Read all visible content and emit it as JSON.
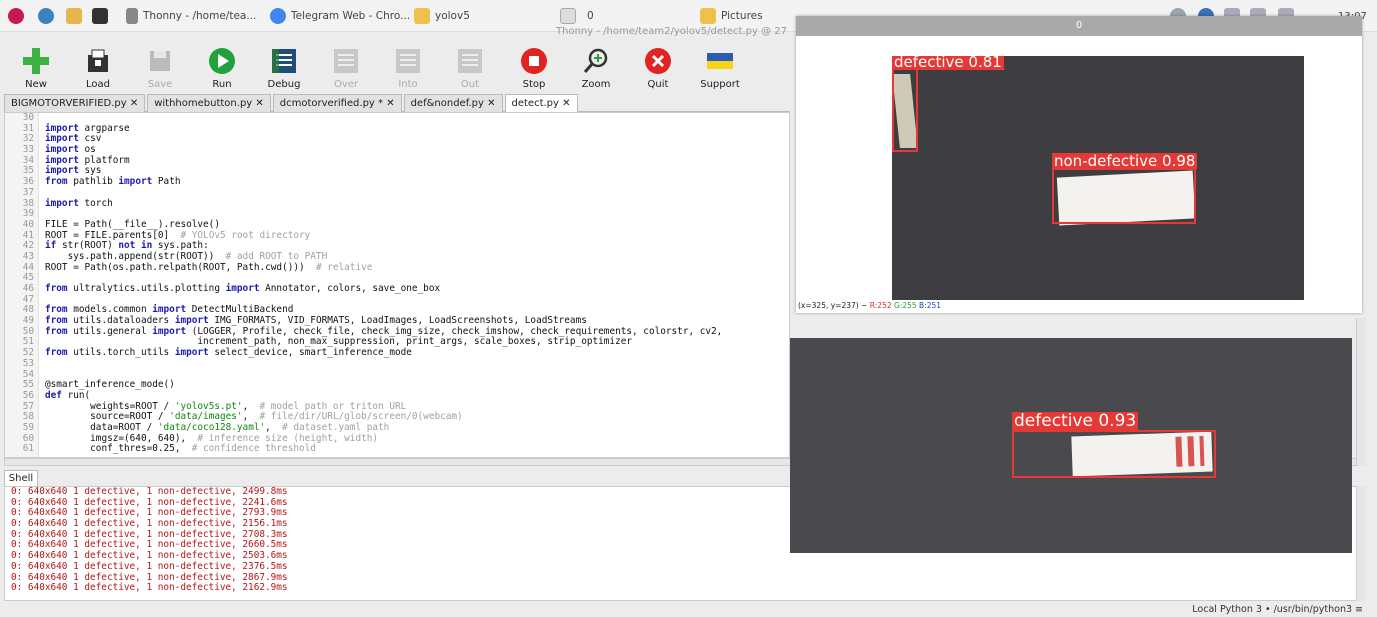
{
  "taskbar": {
    "items": [
      {
        "label": "Thonny - /home/tea..."
      },
      {
        "label": "Telegram Web - Chro..."
      },
      {
        "label": "yolov5"
      },
      {
        "label": "0"
      },
      {
        "label": "Pictures"
      }
    ],
    "clock": "13:07"
  },
  "window_title": "Thonny - /home/team2/yolov5/detect.py @ 27",
  "toolbar": {
    "new": "New",
    "load": "Load",
    "save": "Save",
    "run": "Run",
    "debug": "Debug",
    "over": "Over",
    "into": "Into",
    "out": "Out",
    "stop": "Stop",
    "zoom": "Zoom",
    "quit": "Quit",
    "support": "Support"
  },
  "editor_tabs": [
    {
      "label": "BIGMOTORVERIFIED.py ✕"
    },
    {
      "label": "withhomebutton.py ✕"
    },
    {
      "label": "dcmotorverified.py * ✕"
    },
    {
      "label": "def&nondef.py ✕"
    },
    {
      "label": "detect.py ✕"
    }
  ],
  "code": {
    "line_numbers": [
      "30",
      "31",
      "32",
      "33",
      "34",
      "35",
      "36",
      "37",
      "38",
      "39",
      "40",
      "41",
      "42",
      "43",
      "44",
      "45",
      "46",
      "47",
      "48",
      "49",
      "50",
      "51",
      "52",
      "53",
      "54",
      "55",
      "56",
      "57",
      "58",
      "59",
      "60",
      "61"
    ],
    "lines": [
      "",
      "import argparse",
      "import csv",
      "import os",
      "import platform",
      "import sys",
      "from pathlib import Path",
      "",
      "import torch",
      "",
      "FILE = Path(__file__).resolve()",
      "ROOT = FILE.parents[0]  # YOLOv5 root directory",
      "if str(ROOT) not in sys.path:",
      "    sys.path.append(str(ROOT))  # add ROOT to PATH",
      "ROOT = Path(os.path.relpath(ROOT, Path.cwd()))  # relative",
      "",
      "from ultralytics.utils.plotting import Annotator, colors, save_one_box",
      "",
      "from models.common import DetectMultiBackend",
      "from utils.dataloaders import IMG_FORMATS, VID_FORMATS, LoadImages, LoadScreenshots, LoadStreams",
      "from utils.general import (LOGGER, Profile, check_file, check_img_size, check_imshow, check_requirements, colorstr, cv2,",
      "                           increment_path, non_max_suppression, print_args, scale_boxes, strip_optimizer",
      "from utils.torch_utils import select_device, smart_inference_mode",
      "",
      "",
      "@smart_inference_mode()",
      "def run(",
      "        weights=ROOT / 'yolov5s.pt',  # model path or triton URL",
      "        source=ROOT / 'data/images',  # file/dir/URL/glob/screen/0(webcam)",
      "        data=ROOT / 'data/coco128.yaml',  # dataset.yaml path",
      "        imgsz=(640, 640),  # inference size (height, width)",
      "        conf_thres=0.25,  # confidence threshold"
    ]
  },
  "shell": {
    "tab_label": "Shell",
    "lines": [
      "0: 640x640 1 defective, 1 non-defective, 2499.8ms",
      "0: 640x640 1 defective, 1 non-defective, 2241.6ms",
      "0: 640x640 1 defective, 1 non-defective, 2793.9ms",
      "0: 640x640 1 defective, 1 non-defective, 2156.1ms",
      "0: 640x640 1 defective, 1 non-defective, 2708.3ms",
      "0: 640x640 1 defective, 1 non-defective, 2660.5ms",
      "0: 640x640 1 defective, 1 non-defective, 2503.6ms",
      "0: 640x640 1 defective, 1 non-defective, 2376.5ms",
      "0: 640x640 1 defective, 1 non-defective, 2867.9ms",
      "0: 640x640 1 defective, 1 non-defective, 2162.9ms"
    ]
  },
  "status_bar": "Local Python 3  •  /usr/bin/python3  ≡",
  "window0": {
    "title": "0",
    "detections": [
      {
        "label": "defective 0.81"
      },
      {
        "label": "non-defective 0.98"
      }
    ],
    "pixel_info": {
      "coords": "(x=325, y=237) ~",
      "r": "R:252",
      "g": "G:255",
      "b": "B:251"
    }
  },
  "window1": {
    "detections": [
      {
        "label": "defective 0.93"
      }
    ]
  },
  "colors": {
    "box": "#e53935",
    "shell_text": "#b2181b",
    "keyword": "#1a1ab0"
  }
}
